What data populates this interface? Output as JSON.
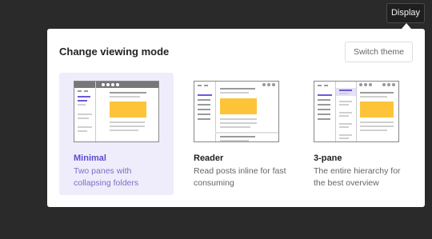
{
  "header_button": {
    "label": "Display"
  },
  "panel": {
    "title": "Change viewing mode",
    "switch_theme_label": "Switch theme"
  },
  "modes": [
    {
      "title": "Minimal",
      "description": "Two panes with collapsing folders",
      "selected": true
    },
    {
      "title": "Reader",
      "description": "Read posts inline for fast consuming",
      "selected": false
    },
    {
      "title": "3-pane",
      "description": "The entire hierarchy for the best overview",
      "selected": false
    }
  ],
  "colors": {
    "accent": "#5b4bd0",
    "selected_bg": "#efedfb",
    "image_placeholder": "#fdc43a"
  }
}
